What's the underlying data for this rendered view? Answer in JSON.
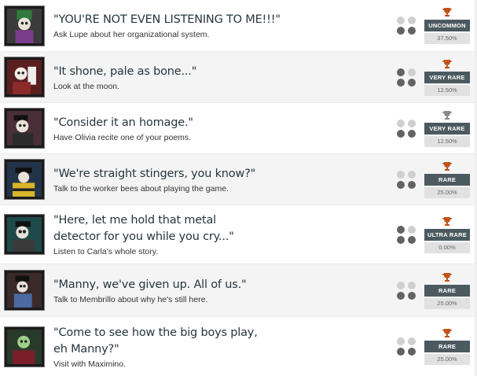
{
  "colors": {
    "trophy_gold": "#c0541a",
    "trophy_silver": "#8a8a8a",
    "badge_bg": "#4c5a60",
    "title_text": "#26363d"
  },
  "achievements": [
    {
      "title": "\"YOU'RE NOT EVEN LISTENING TO ME!!!\"",
      "description": "Ask Lupe about her organizational system.",
      "rarity": "UNCOMMON",
      "percent": "37.50%",
      "trophy_icon": "trophy-gold-icon",
      "dots_filled": 2
    },
    {
      "title": "\"It shone, pale as bone...\"",
      "description": "Look at the moon.",
      "rarity": "VERY RARE",
      "percent": "12.50%",
      "trophy_icon": "trophy-gold-icon",
      "dots_filled": 3
    },
    {
      "title": "\"Consider it an homage.\"",
      "description": "Have Olivia recite one of your poems.",
      "rarity": "VERY RARE",
      "percent": "12.50%",
      "trophy_icon": "trophy-silver-icon",
      "dots_filled": 2
    },
    {
      "title": "\"We're straight stingers, you know?\"",
      "description": "Talk to the worker bees about playing the game.",
      "rarity": "RARE",
      "percent": "25.00%",
      "trophy_icon": "trophy-gold-icon",
      "dots_filled": 2
    },
    {
      "title": "\"Here, let me hold that metal detector for you while you cry...\"",
      "description": "Listen to Carla's whole story.",
      "rarity": "ULTRA RARE",
      "percent": "0.00%",
      "trophy_icon": "trophy-gold-icon",
      "dots_filled": 3
    },
    {
      "title": "\"Manny, we've given up. All of us.\"",
      "description": "Talk to Membrillo about why he's still here.",
      "rarity": "RARE",
      "percent": "25.00%",
      "trophy_icon": "trophy-gold-icon",
      "dots_filled": 2
    },
    {
      "title": "\"Come to see how the big boys play, eh Manny?\"",
      "description": "Visit with Maximino.",
      "rarity": "RARE",
      "percent": "25.00%",
      "trophy_icon": "trophy-gold-icon",
      "dots_filled": 2
    }
  ]
}
